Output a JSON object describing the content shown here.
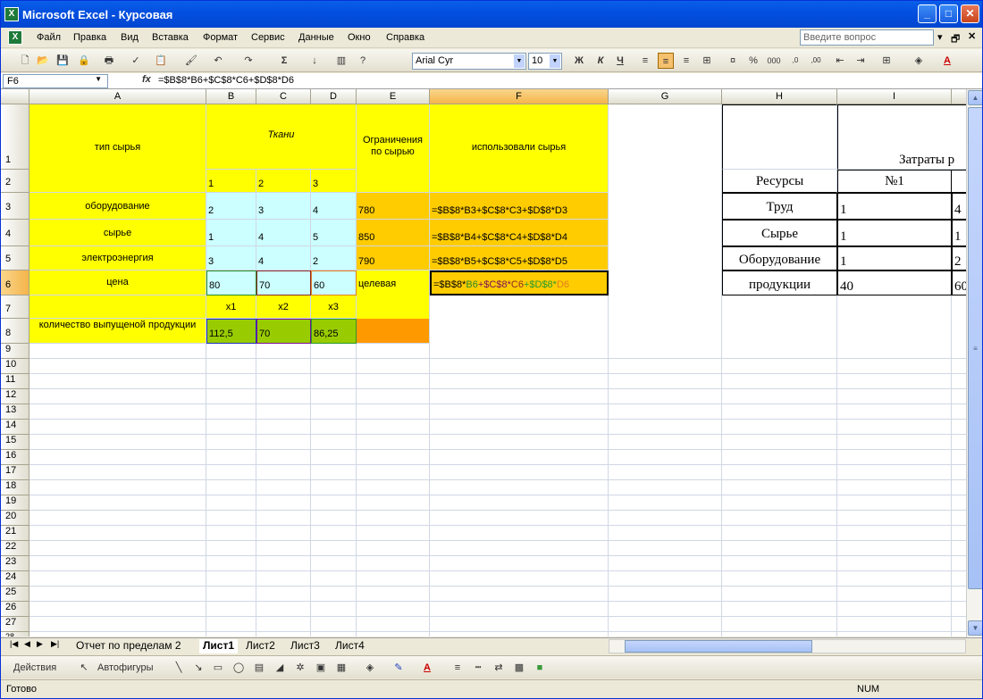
{
  "window": {
    "title": "Microsoft Excel - Курсовая"
  },
  "menu": [
    "Файл",
    "Правка",
    "Вид",
    "Вставка",
    "Формат",
    "Сервис",
    "Данные",
    "Окно",
    "Справка"
  ],
  "help_placeholder": "Введите вопрос",
  "toolbar": {
    "font": "Arial Cyr",
    "size": "10",
    "bold": "Ж",
    "italic": "К",
    "underline": "Ч"
  },
  "formula_bar": {
    "name_box": "F6",
    "fx": "fx",
    "formula": "=$B$8*B6+$C$8*C6+$D$8*D6"
  },
  "columns": [
    "A",
    "B",
    "C",
    "D",
    "E",
    "F",
    "G",
    "H",
    "I"
  ],
  "rows": [
    "1",
    "2",
    "3",
    "4",
    "5",
    "6",
    "7",
    "8",
    "9",
    "10",
    "11",
    "12",
    "13",
    "14",
    "15",
    "16",
    "17",
    "18",
    "19",
    "20",
    "21",
    "22",
    "23",
    "24",
    "25",
    "26",
    "27",
    "28"
  ],
  "cells": {
    "A1": "тип сырья",
    "B1": "Ткани",
    "B2": "1",
    "C2": "2",
    "D2": "3",
    "E1": "Ограничения по сырью",
    "F1": "использовали сырья",
    "A3": "оборудование",
    "B3": "2",
    "C3": "3",
    "D3": "4",
    "E3": "780",
    "F3": "=$B$8*B3+$C$8*C3+$D$8*D3",
    "A4": "сырье",
    "B4": "1",
    "C4": "4",
    "D4": "5",
    "E4": "850",
    "F4": "=$B$8*B4+$C$8*C4+$D$8*D4",
    "A5": "электроэнергия",
    "B5": "3",
    "C5": "4",
    "D5": "2",
    "E5": "790",
    "F5": "=$B$8*B5+$C$8*C5+$D$8*D5",
    "A6": "цена",
    "B6": "80",
    "C6": "70",
    "D6": "60",
    "E6": "целевая",
    "F6a": "=$B$8*",
    "F6b": "B6",
    "F6c": "+$C$8*",
    "F6d": "C6",
    "F6e": "+$D$8*",
    "F6f": "D6",
    "B7": "x1",
    "C7": "x2",
    "D7": "x3",
    "A8": "количество выпущеной продукции",
    "B8": "112,5",
    "C8": "70",
    "D8": "86,25",
    "I1": "Затраты р",
    "H2": "Ресурсы",
    "I2": "№1",
    "H3": "Труд",
    "I3": "1",
    "J3": "4",
    "H4": "Сырье",
    "I4": "1",
    "J4": "1",
    "H5": "Оборудование",
    "I5": "1",
    "J5": "2",
    "H6": "продукции",
    "I6": "40",
    "J6": "60"
  },
  "sheet_tabs": [
    "Отчет по пределам 2",
    "Лист1",
    "Лист2",
    "Лист3",
    "Лист4"
  ],
  "active_tab": "Лист1",
  "drawing": {
    "actions": "Действия",
    "autoshapes": "Автофигуры"
  },
  "status": {
    "ready": "Готово",
    "num": "NUM"
  }
}
